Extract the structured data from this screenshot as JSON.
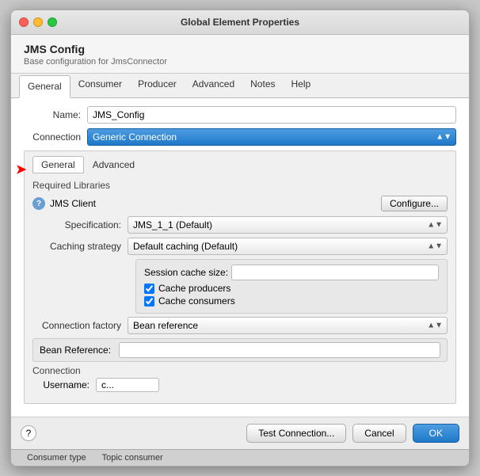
{
  "window": {
    "title": "Global Element Properties"
  },
  "header": {
    "title": "JMS Config",
    "subtitle": "Base configuration for JmsConnector"
  },
  "main_tabs": [
    {
      "label": "General",
      "active": true
    },
    {
      "label": "Consumer",
      "active": false
    },
    {
      "label": "Producer",
      "active": false
    },
    {
      "label": "Advanced",
      "active": false
    },
    {
      "label": "Notes",
      "active": false
    },
    {
      "label": "Help",
      "active": false
    }
  ],
  "name_field": {
    "label": "Name:",
    "value": "JMS_Config"
  },
  "connection_field": {
    "label": "Connection",
    "value": "Generic Connection"
  },
  "inner_tabs": [
    {
      "label": "General",
      "active": true
    },
    {
      "label": "Advanced",
      "active": false
    }
  ],
  "required_libraries": {
    "title": "Required Libraries",
    "library": "JMS Client",
    "configure_btn": "Configure..."
  },
  "specification": {
    "label": "Specification:",
    "value": "JMS_1_1 (Default)"
  },
  "caching_strategy": {
    "label": "Caching strategy",
    "value": "Default caching (Default)"
  },
  "cache_box": {
    "session_cache_label": "Session cache size:",
    "session_cache_value": "",
    "cache_producers_label": "Cache producers",
    "cache_consumers_label": "Cache consumers"
  },
  "connection_factory": {
    "label": "Connection factory",
    "value": "Bean reference"
  },
  "bean_reference": {
    "label": "Bean Reference:",
    "value": ""
  },
  "connection_section": {
    "title": "Connection",
    "username_label": "Username:",
    "username_value": "c..."
  },
  "footer": {
    "help_icon": "?",
    "test_connection_btn": "Test Connection...",
    "cancel_btn": "Cancel",
    "ok_btn": "OK"
  },
  "bottom_tabs": [
    {
      "label": "Consumer type",
      "active": false
    },
    {
      "label": "Topic consumer",
      "active": false
    }
  ]
}
